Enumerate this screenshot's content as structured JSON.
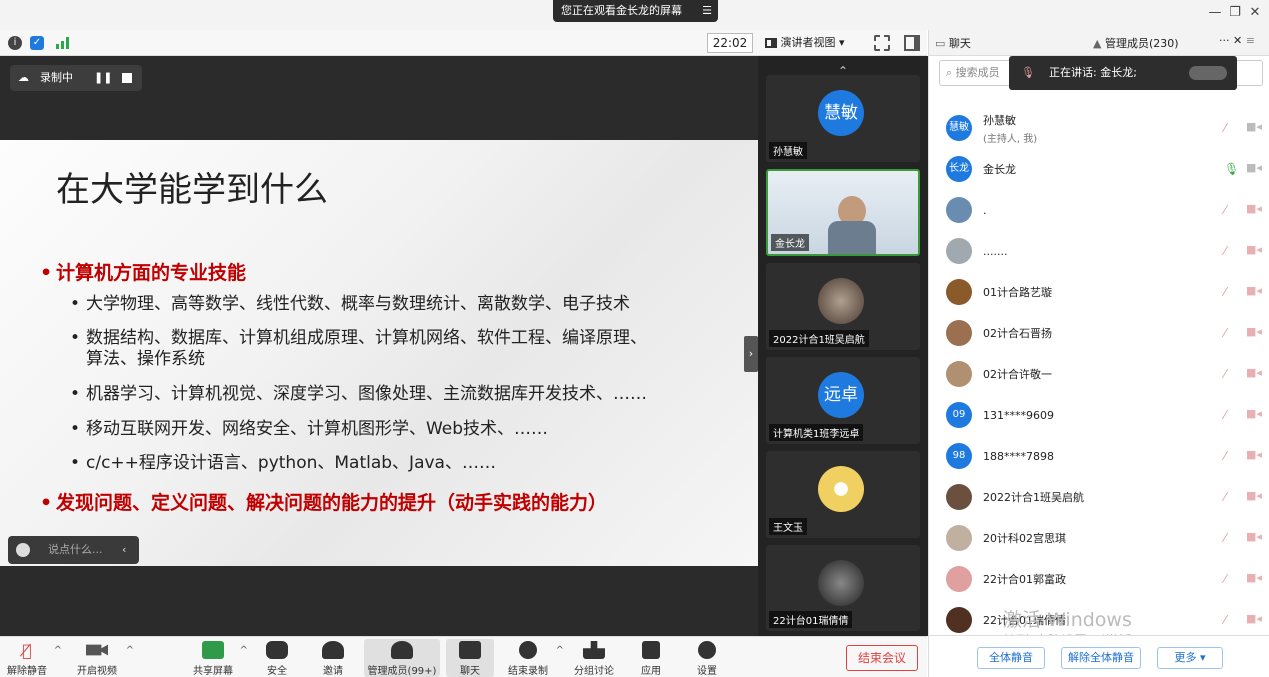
{
  "top": {
    "share_banner": "您正在观看金长龙的屏幕",
    "banner_menu_icon": "list-icon",
    "window_controls": [
      "minimize-icon",
      "maximize-icon",
      "close-icon"
    ]
  },
  "toolbar": {
    "clock": "22:02",
    "speaker_view": "演讲者视图",
    "icons": [
      "info-icon",
      "shield-icon",
      "signal-icon",
      "fullscreen-icon",
      "layout-icon"
    ]
  },
  "recording": {
    "label": "录制中"
  },
  "slide": {
    "title": "在大学能学到什么",
    "heading1": "计算机方面的专业技能",
    "items": [
      "大学物理、高等数学、线性代数、概率与数理统计、离散数学、电子技术",
      "数据结构、数据库、计算机组成原理、计算机网络、软件工程、编译原理、",
      "算法、操作系统",
      "机器学习、计算机视觉、深度学习、图像处理、主流数据库开发技术、……",
      "移动互联网开发、网络安全、计算机图形学、Web技术、……",
      "c/c++程序设计语言、python、Matlab、Java、……"
    ],
    "heading2": "发现问题、定义问题、解决问题的能力的提升（动手实践的能力）"
  },
  "chat_input": {
    "placeholder": "说点什么..."
  },
  "thumbnails": [
    {
      "avatar_text": "慧敏",
      "label": "孙慧敏"
    },
    {
      "avatar_text": "",
      "label": "金长龙"
    },
    {
      "avatar_text": "",
      "label": "2022计合1班吴启航"
    },
    {
      "avatar_text": "远卓",
      "label": "计算机类1班李远卓"
    },
    {
      "avatar_text": "",
      "label": "王文玉"
    },
    {
      "avatar_text": "",
      "label": "22计台01瑞倩倩"
    }
  ],
  "bottom": {
    "buttons": [
      "解除静音",
      "开启视频",
      "共享屏幕",
      "安全",
      "邀请",
      "管理成员(99+)",
      "聊天",
      "结束录制",
      "分组讨论",
      "应用",
      "设置"
    ],
    "end_meeting": "结束会议"
  },
  "right_panel": {
    "tab_chat": "聊天",
    "tab_members": "管理成员(230)",
    "tab_more": "···",
    "search_placeholder": "搜索成员",
    "speaking": "正在讲话: 金长龙;",
    "members": [
      {
        "avatar": "慧敏",
        "name": "孙慧敏",
        "sub": "(主持人, 我)",
        "color": "#1f7ae0"
      },
      {
        "avatar": "长龙",
        "name": "金长龙",
        "sub": "",
        "color": "#1f7ae0"
      },
      {
        "avatar": "",
        "name": ".",
        "sub": "",
        "color": "#6a8cb0"
      },
      {
        "avatar": "",
        "name": ".......",
        "sub": "",
        "color": "#a0a8b0"
      },
      {
        "avatar": "",
        "name": "01计合路艺璇",
        "sub": "",
        "color": "#8b5a2b"
      },
      {
        "avatar": "",
        "name": "02计合石晋扬",
        "sub": "",
        "color": "#9a7050"
      },
      {
        "avatar": "",
        "name": "02计合许敬一",
        "sub": "",
        "color": "#b09070"
      },
      {
        "avatar": "09",
        "name": "131****9609",
        "sub": "",
        "color": "#1f7ae0"
      },
      {
        "avatar": "98",
        "name": "188****7898",
        "sub": "",
        "color": "#1f7ae0"
      },
      {
        "avatar": "",
        "name": "2022计合1班吴启航",
        "sub": "",
        "color": "#6b5040"
      },
      {
        "avatar": "",
        "name": "20计科02宫思琪",
        "sub": "",
        "color": "#c0b0a0"
      },
      {
        "avatar": "",
        "name": "22计合01郭富政",
        "sub": "",
        "color": "#e0a0a0"
      },
      {
        "avatar": "",
        "name": "22计合01瑞倩倩",
        "sub": "",
        "color": "#503020"
      }
    ],
    "mute_all": "全体静音",
    "unmute_all": "解除全体静音",
    "more": "更多 ▾"
  },
  "watermark": {
    "line1": "激活 Windows",
    "line2": "转到\"电脑设置\"以激活 Windows。"
  }
}
